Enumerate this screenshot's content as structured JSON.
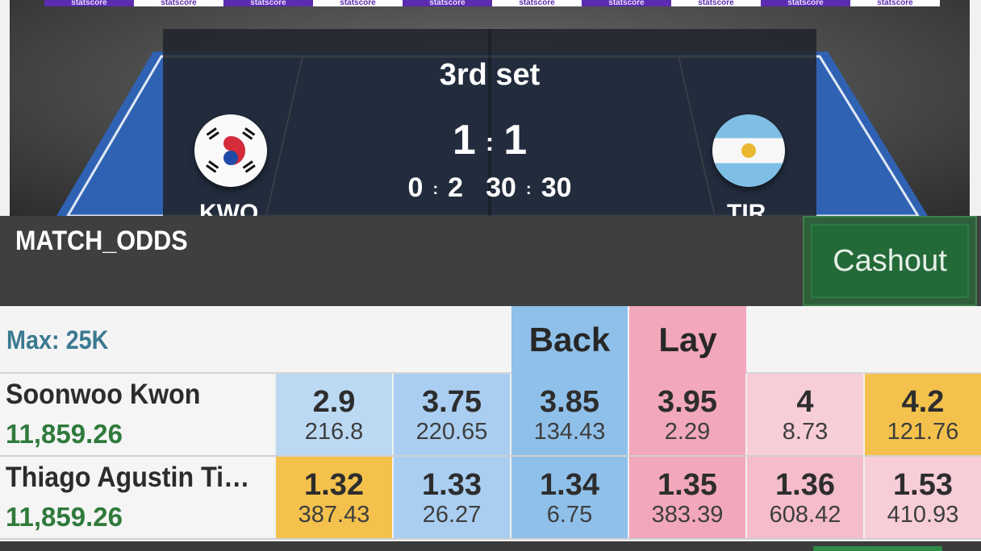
{
  "scoreboard": {
    "ad_text": "statscore",
    "set_label": "3rd set",
    "sets": {
      "home": "1",
      "away": "1",
      "separator": ":"
    },
    "games": {
      "home": "0",
      "away": "2"
    },
    "points": {
      "home": "30",
      "away": "30"
    },
    "home_abbr": "KWO",
    "away_abbr": "TIR"
  },
  "market": {
    "title": "MATCH_ODDS",
    "cashout_label": "Cashout"
  },
  "table": {
    "max_label": "Max: 25K",
    "back_label": "Back",
    "lay_label": "Lay",
    "runners": [
      {
        "name": "Soonwoo Kwon",
        "pnl": "11,859.26",
        "odds": [
          {
            "price": "2.9",
            "size": "216.8"
          },
          {
            "price": "3.75",
            "size": "220.65"
          },
          {
            "price": "3.85",
            "size": "134.43"
          },
          {
            "price": "3.95",
            "size": "2.29"
          },
          {
            "price": "4",
            "size": "8.73"
          },
          {
            "price": "4.2",
            "size": "121.76"
          }
        ]
      },
      {
        "name": "Thiago Agustin Tir…",
        "pnl": "11,859.26",
        "odds": [
          {
            "price": "1.32",
            "size": "387.43"
          },
          {
            "price": "1.33",
            "size": "26.27"
          },
          {
            "price": "1.34",
            "size": "6.75"
          },
          {
            "price": "1.35",
            "size": "383.39"
          },
          {
            "price": "1.36",
            "size": "608.42"
          },
          {
            "price": "1.53",
            "size": "410.93"
          }
        ]
      }
    ]
  },
  "colors": {
    "back": "#8fc0ea",
    "lay": "#f2a7bb",
    "highlight": "#f3c14c",
    "pnl_positive": "#2f7a3c",
    "cashout": "#246a39"
  }
}
